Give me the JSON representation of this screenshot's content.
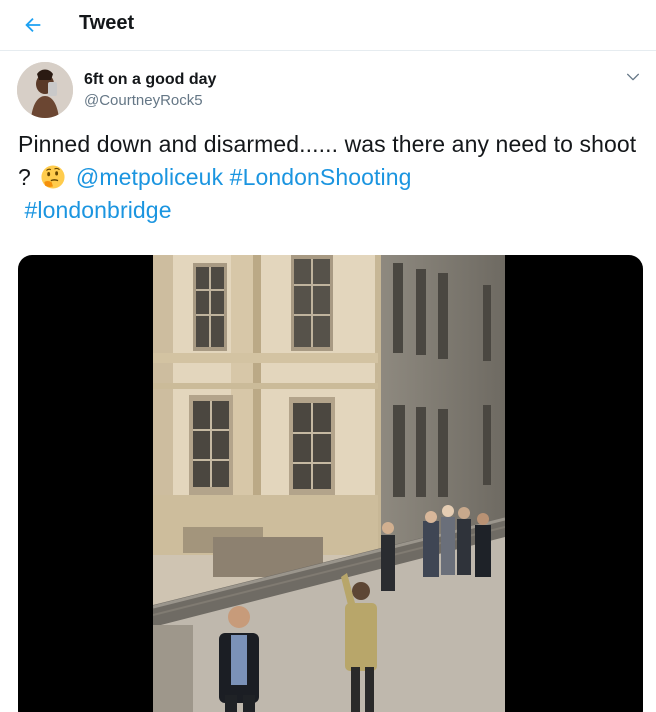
{
  "header": {
    "title": "Tweet",
    "back_icon": "arrow-left-icon",
    "accent": "#1da1f2"
  },
  "tweet": {
    "author": {
      "display_name": "6ft on a good day",
      "username": "@CourtneyRock5",
      "avatar_icon": "user-avatar"
    },
    "caret_icon": "chevron-down-icon",
    "text": {
      "part1": "Pinned down and disarmed...... was there any need to shoot ? ",
      "emoji": "thinking-face-emoji",
      "mention": "@metpoliceuk",
      "hashtag1": "#LondonShooting",
      "hashtag2": "#londonbridge"
    },
    "link_color": "#1b95e0",
    "media": {
      "type": "video",
      "description_icon": "video-still"
    }
  }
}
